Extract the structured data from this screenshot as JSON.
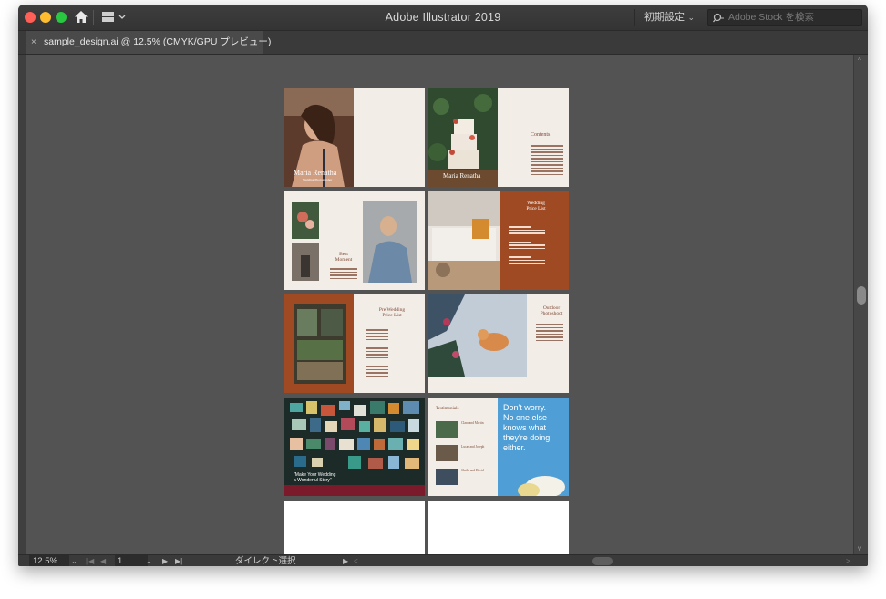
{
  "window": {
    "app_title": "Adobe Illustrator 2019",
    "workspace_preset": "初期設定",
    "search_placeholder": "Adobe Stock を検索"
  },
  "document_tab": {
    "close_glyph": "×",
    "title": "sample_design.ai @ 12.5% (CMYK/GPU プレビュー)"
  },
  "status_bar": {
    "zoom": "12.5%",
    "artboard": "1",
    "tool": "ダイレクト選択"
  },
  "artboards": {
    "p1_name": "Maria Renatha",
    "p1_subtitle": "Wedding Photographer",
    "p2_name": "Maria Renatha",
    "p2_heading": "Contents",
    "p3_heading_l1": "Best",
    "p3_heading_l2": "Moment",
    "p4_heading_l1": "Wedding",
    "p4_heading_l2": "Price List",
    "p6_heading_l1": "Pre Wedding",
    "p6_heading_l2": "Price List",
    "p8_heading_l1": "Outdoor",
    "p8_heading_l2": "Photoshoot",
    "p9_quote_l1": "\"Make Your Wedding",
    "p9_quote_l2": "a Wonderful Story\"",
    "p10_heading": "Testimonials",
    "p10_names": [
      "Clara and Martin",
      "Lucas and Joseph",
      "Sheila and David"
    ],
    "p10_big_lines": [
      "Don't worry.",
      "No one else",
      "knows what",
      "they're doing",
      "either."
    ]
  },
  "colors": {
    "accent_rust": "#a04a24",
    "cream": "#f3ede8",
    "canvas_gray": "#535353"
  }
}
